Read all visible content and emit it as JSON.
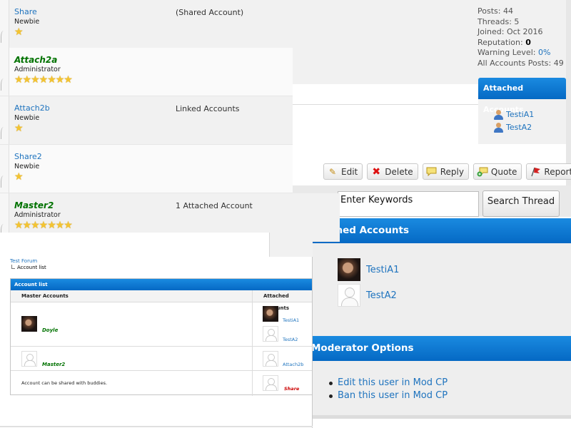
{
  "post": {
    "stats": {
      "posts": "Posts: 44",
      "threads": "Threads: 5",
      "joined": "Joined: Oct 2016",
      "reputation_label": "Reputation:",
      "reputation_value": "0",
      "warning_label": "Warning Level:",
      "warning_value": "0%",
      "all_accounts_posts": "All Accounts Posts: 49"
    },
    "attached_accounts_title": "Attached Accounts",
    "attached_accounts": [
      "TestiA1",
      "TestA2"
    ],
    "buttons": {
      "edit": "Edit",
      "delete": "Delete",
      "reply": "Reply",
      "quote": "Quote",
      "report": "Report"
    }
  },
  "accounts": [
    {
      "name": "Share",
      "role": "Newbie",
      "stars": "★",
      "info": "(Shared Account)"
    },
    {
      "name": "Attach2a",
      "role": "Administrator",
      "stars": "★★★★★★★",
      "info": ""
    },
    {
      "name": "Attach2b",
      "role": "Newbie",
      "stars": "★",
      "info": "Linked Accounts"
    },
    {
      "name": "Share2",
      "role": "Newbie",
      "stars": "★",
      "info": ""
    },
    {
      "name": "Master2",
      "role": "Administrator",
      "stars": "★★★★★★★",
      "info": "1 Attached Account"
    }
  ],
  "search": {
    "placeholder": "Enter Keywords",
    "button": "Search Thread"
  },
  "profile": {
    "attached_title": "Attached Accounts",
    "attached": [
      "TestiA1",
      "TestA2"
    ],
    "moderator_title": "Moderator Options",
    "moderator_links": [
      "Edit this user in Mod CP",
      "Ban this user in Mod CP"
    ]
  },
  "account_list": {
    "breadcrumb_root": "Test Forum",
    "breadcrumb_current": "Account list",
    "title": "Account list",
    "col_master": "Master Accounts",
    "col_attached": "Attached Accounts",
    "rows": {
      "doyle": "Doyle",
      "testia1": "TestiA1",
      "testa2": "TestA2",
      "master2": "Master2",
      "attach2b": "Attach2b",
      "shared_note": "Account can be shared with buddies.",
      "share": "Share"
    }
  },
  "colors": {
    "link": "#1e73be",
    "admin_green": "#007200",
    "header_blue": "#0a78d4",
    "shared_red": "#cc0000"
  }
}
